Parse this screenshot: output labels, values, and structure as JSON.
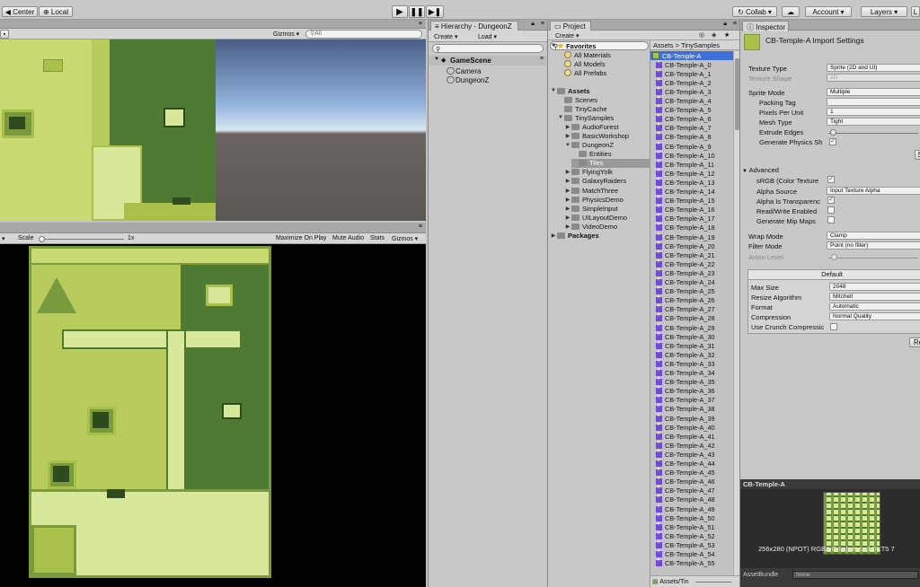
{
  "toolbar": {
    "center_label": "Center",
    "local_label": "Local",
    "collab_label": "Collab",
    "account_label": "Account",
    "layers_label": "Layers",
    "layout_label": "L"
  },
  "scene_view": {
    "gizmos_label": "Gizmos",
    "search_placeholder": "All"
  },
  "game_view": {
    "scale_label": "Scale",
    "scale_value": "1x",
    "maximize_label": "Maximize On Play",
    "mute_label": "Mute Audio",
    "stats_label": "Stats",
    "gizmos_label": "Gizmos"
  },
  "hierarchy": {
    "tab_label": "Hierarchy - DungeonZ",
    "create_label": "Create",
    "load_label": "Load",
    "scene_name": "GameScene",
    "items": [
      "Camera",
      "DungeonZ"
    ]
  },
  "project": {
    "tab_label": "Project",
    "create_label": "Create",
    "breadcrumb_root": "Assets",
    "breadcrumb_child": "TinySamples",
    "footer_path": "Assets/Tin",
    "favorites_label": "Favorites",
    "favorites": [
      "All Materials",
      "All Models",
      "All Prefabs"
    ],
    "assets_label": "Assets",
    "tree": [
      {
        "label": "Scenes",
        "indent": 1
      },
      {
        "label": "TinyCache",
        "indent": 1
      },
      {
        "label": "TinySamples",
        "indent": 1
      },
      {
        "label": "AudioForest",
        "indent": 2
      },
      {
        "label": "BasicWorkshop",
        "indent": 2
      },
      {
        "label": "DungeonZ",
        "indent": 2
      },
      {
        "label": "Entities",
        "indent": 3
      },
      {
        "label": "Tiles",
        "indent": 3
      },
      {
        "label": "FlyingYolk",
        "indent": 2
      },
      {
        "label": "GalaxyRaiders",
        "indent": 2
      },
      {
        "label": "MatchThree",
        "indent": 2
      },
      {
        "label": "PhysicsDemo",
        "indent": 2
      },
      {
        "label": "SimpleInput",
        "indent": 2
      },
      {
        "label": "UILayoutDemo",
        "indent": 2
      },
      {
        "label": "VideoDemo",
        "indent": 2
      }
    ],
    "packages_label": "Packages",
    "files": [
      "CB-Temple-A",
      "CB-Temple-A_0",
      "CB-Temple-A_1",
      "CB-Temple-A_2",
      "CB-Temple-A_3",
      "CB-Temple-A_4",
      "CB-Temple-A_5",
      "CB-Temple-A_6",
      "CB-Temple-A_7",
      "CB-Temple-A_8",
      "CB-Temple-A_9",
      "CB-Temple-A_10",
      "CB-Temple-A_11",
      "CB-Temple-A_12",
      "CB-Temple-A_13",
      "CB-Temple-A_14",
      "CB-Temple-A_15",
      "CB-Temple-A_16",
      "CB-Temple-A_17",
      "CB-Temple-A_18",
      "CB-Temple-A_19",
      "CB-Temple-A_20",
      "CB-Temple-A_21",
      "CB-Temple-A_22",
      "CB-Temple-A_23",
      "CB-Temple-A_24",
      "CB-Temple-A_25",
      "CB-Temple-A_26",
      "CB-Temple-A_27",
      "CB-Temple-A_28",
      "CB-Temple-A_29",
      "CB-Temple-A_30",
      "CB-Temple-A_31",
      "CB-Temple-A_32",
      "CB-Temple-A_33",
      "CB-Temple-A_34",
      "CB-Temple-A_35",
      "CB-Temple-A_36",
      "CB-Temple-A_37",
      "CB-Temple-A_38",
      "CB-Temple-A_39",
      "CB-Temple-A_40",
      "CB-Temple-A_41",
      "CB-Temple-A_42",
      "CB-Temple-A_43",
      "CB-Temple-A_44",
      "CB-Temple-A_45",
      "CB-Temple-A_46",
      "CB-Temple-A_47",
      "CB-Temple-A_48",
      "CB-Temple-A_49",
      "CB-Temple-A_50",
      "CB-Temple-A_51",
      "CB-Temple-A_52",
      "CB-Temple-A_53",
      "CB-Temple-A_54",
      "CB-Temple-A_55"
    ]
  },
  "inspector": {
    "tab_label": "Inspector",
    "title": "CB-Temple-A Import Settings",
    "texture_type_label": "Texture Type",
    "texture_type_value": "Sprite (2D and UI)",
    "texture_shape_label": "Texture Shape",
    "texture_shape_value": "2D",
    "sprite_mode_label": "Sprite Mode",
    "sprite_mode_value": "Multiple",
    "packing_tag_label": "Packing Tag",
    "pixels_per_unit_label": "Pixels Per Unit",
    "pixels_per_unit_value": "1",
    "mesh_type_label": "Mesh Type",
    "mesh_type_value": "Tight",
    "extrude_edges_label": "Extrude Edges",
    "generate_physics_label": "Generate Physics Sh",
    "generate_physics_checked": true,
    "advanced_label": "Advanced",
    "srgb_label": "sRGB (Color Texture",
    "srgb_checked": true,
    "alpha_source_label": "Alpha Source",
    "alpha_source_value": "Input Texture Alpha",
    "alpha_transparency_label": "Alpha Is Transparenc",
    "alpha_transparency_checked": true,
    "read_write_label": "Read/Write Enabled",
    "read_write_checked": false,
    "mipmaps_label": "Generate Mip Maps",
    "mipmaps_checked": false,
    "wrap_mode_label": "Wrap Mode",
    "wrap_mode_value": "Clamp",
    "filter_mode_label": "Filter Mode",
    "filter_mode_value": "Point (no filter)",
    "aniso_label": "Aniso Level",
    "platform_tab_label": "Default",
    "max_size_label": "Max Size",
    "max_size_value": "2048",
    "resize_label": "Resize Algorithm",
    "resize_value": "Mitchell",
    "format_label": "Format",
    "format_value": "Automatic",
    "compression_label": "Compression",
    "compression_value": "Normal Quality",
    "crunch_label": "Use Crunch Compressic",
    "crunch_checked": false,
    "revert_label": "Re",
    "edit_label": "S",
    "preview_title": "CB-Temple-A",
    "preview_info": "256x280 (NPOT)  RGBA Compressed DXT5  7",
    "assetbundle_label": "AssetBundle",
    "assetbundle_value": "None"
  },
  "colors": {
    "gb_light": "#d8e89a",
    "gb_mid": "#a9c14a",
    "gb_dark": "#4f7a34",
    "gb_darkest": "#2f4a1e",
    "selection": "#3d6fd8",
    "sprite_icon": "#6f4bd6"
  }
}
